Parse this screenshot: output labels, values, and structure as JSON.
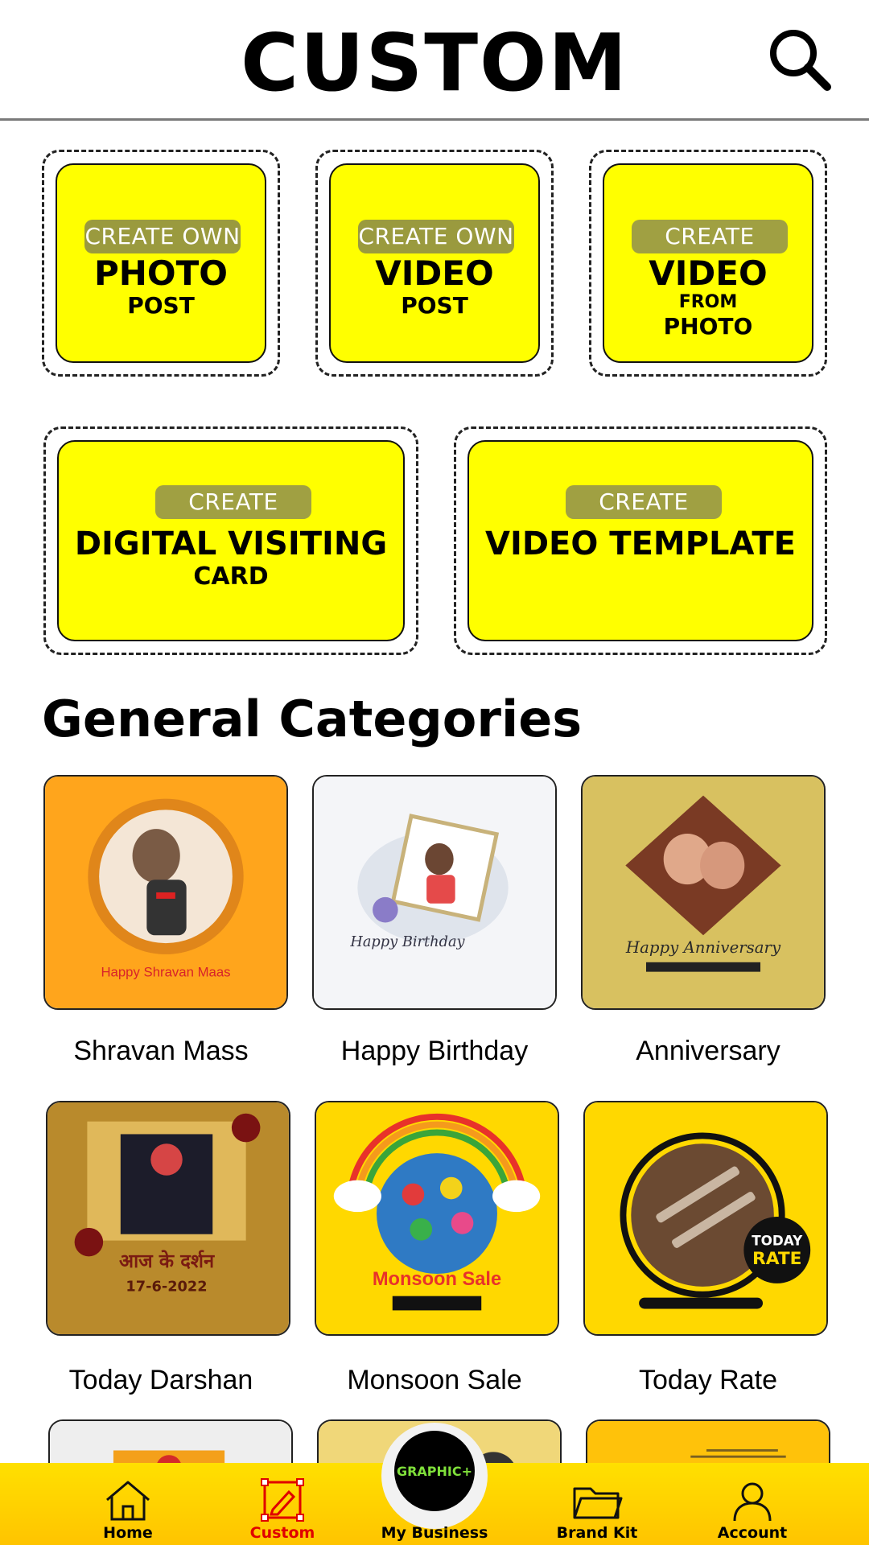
{
  "header": {
    "title": "CUSTOM"
  },
  "create_tiles": [
    {
      "pill": "CREATE OWN",
      "main": "PHOTO",
      "sub": "POST"
    },
    {
      "pill": "CREATE OWN",
      "main": "VIDEO",
      "sub": "POST"
    },
    {
      "pill": "CREATE",
      "main": "VIDEO",
      "sub1": "FROM",
      "sub2": "PHOTO"
    },
    {
      "pill": "CREATE",
      "main": "DIGITAL VISITING",
      "sub": "CARD"
    },
    {
      "pill": "CREATE",
      "main": "VIDEO TEMPLATE"
    }
  ],
  "section": {
    "title": "General Categories"
  },
  "categories": [
    {
      "label": "Shravan Mass",
      "art_text": "Happy Shravan Maas"
    },
    {
      "label": "Happy Birthday",
      "art_text": "Happy Birthday"
    },
    {
      "label": "Anniversary",
      "art_text": "Happy Anniversary"
    },
    {
      "label": "Today Darshan",
      "art_text": "आज के दर्शन",
      "art_date": "17-6-2022"
    },
    {
      "label": "Monsoon Sale",
      "art_text": "Monsoon Sale"
    },
    {
      "label": "Today Rate",
      "art_text_1": "TODAY",
      "art_text_2": "RATE"
    }
  ],
  "center_logo": {
    "text": "GRAPHIC+"
  },
  "nav": [
    {
      "label": "Home",
      "icon": "home-icon"
    },
    {
      "label": "Custom",
      "icon": "custom-pen-icon",
      "active": true
    },
    {
      "label": "My Business",
      "icon": "graphic-logo"
    },
    {
      "label": "Brand Kit",
      "icon": "folder-icon"
    },
    {
      "label": "Account",
      "icon": "account-icon"
    }
  ],
  "colors": {
    "tile_yellow": "#ffff00",
    "nav_yellow": "#ffd000",
    "active_red": "#e00000"
  }
}
